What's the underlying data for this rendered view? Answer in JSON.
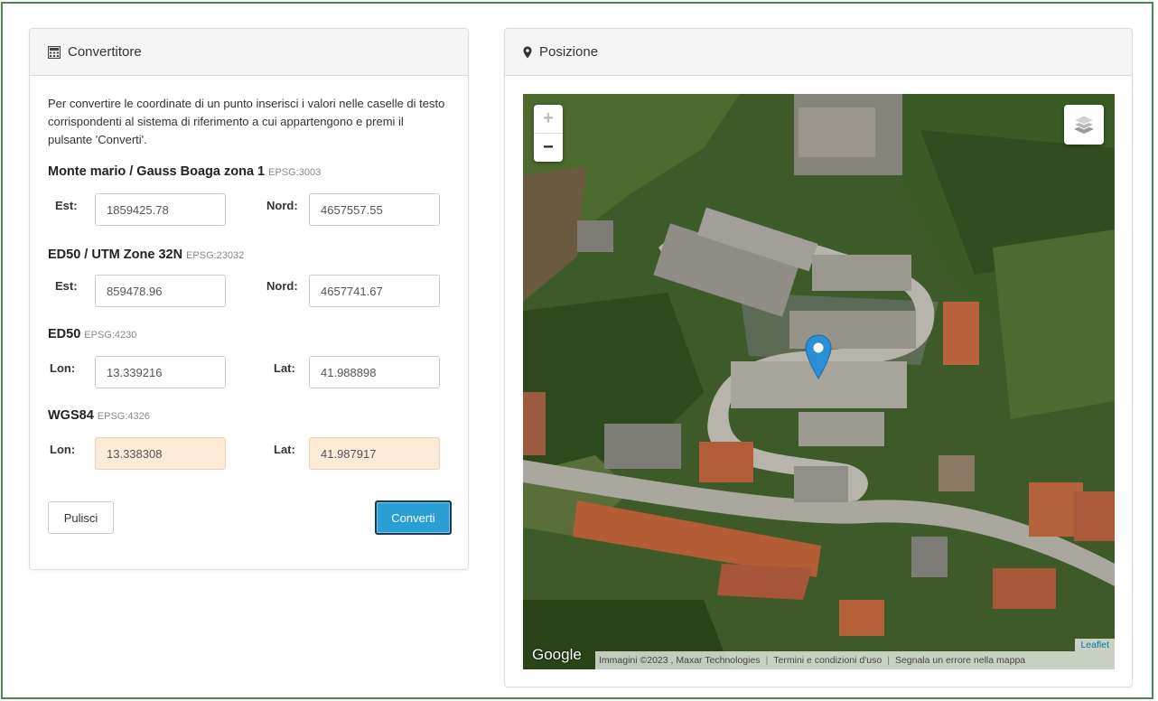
{
  "converter": {
    "title": "Convertitore",
    "icon": "calculator-icon",
    "intro": "Per convertire le coordinate di un punto inserisci i valori nelle caselle di testo corrispondenti al sistema di riferimento a cui appartengono e premi il pulsante 'Converti'.",
    "sections": [
      {
        "name": "Monte mario / Gauss Boaga zona 1",
        "epsg": "EPSG:3003",
        "label1": "Est:",
        "value1": "1859425.78",
        "label2": "Nord:",
        "value2": "4657557.55"
      },
      {
        "name": "ED50 / UTM Zone 32N",
        "epsg": "EPSG:23032",
        "label1": "Est:",
        "value1": "859478.96",
        "label2": "Nord:",
        "value2": "4657741.67"
      },
      {
        "name": "ED50",
        "epsg": "EPSG:4230",
        "label1": "Lon:",
        "value1": "13.339216",
        "label2": "Lat:",
        "value2": "41.988898"
      },
      {
        "name": "WGS84",
        "epsg": "EPSG:4326",
        "label1": "Lon:",
        "value1": "13.338308",
        "label2": "Lat:",
        "value2": "41.987917"
      }
    ],
    "clear_label": "Pulisci",
    "convert_label": "Converti",
    "colors": {
      "convert_button": "#2a9fd6",
      "result_field": "#fcebd7"
    }
  },
  "position": {
    "title": "Posizione",
    "icon": "map-marker-icon",
    "map": {
      "zoom_in": "+",
      "zoom_out": "−",
      "layers_icon": "layers-icon",
      "google_logo": "Google",
      "attribution": "Immagini ©2023 , Maxar Technologies",
      "terms": "Termini e condizioni d'uso",
      "report": "Segnala un errore nella mappa",
      "leaflet": "Leaflet",
      "marker_color": "#2a8fd6"
    }
  }
}
